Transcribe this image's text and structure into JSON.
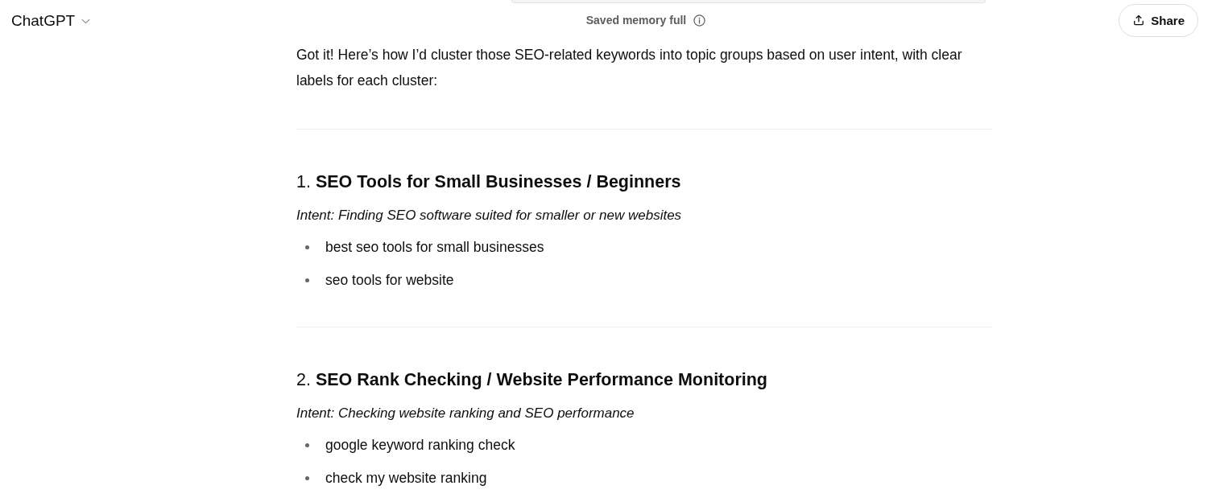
{
  "header": {
    "title": "ChatGPT",
    "notice": "Saved memory full",
    "share_button": "Share"
  },
  "message": {
    "intro": "Got it! Here’s how I’d cluster those SEO-related keywords into topic groups based on user intent, with clear labels for each cluster:",
    "clusters": [
      {
        "heading": "1. **SEO Tools for Small Businesses / Beginners**",
        "intent": "Intent: Finding SEO software suited for smaller or new websites",
        "keywords": [
          "best seo tools for small businesses",
          "seo tools for website"
        ]
      },
      {
        "heading": "2. **SEO Rank Checking / Website Performance Monitoring**",
        "intent": "Intent: Checking website ranking and SEO performance",
        "keywords": [
          "google keyword ranking check",
          "check my website ranking"
        ]
      }
    ]
  }
}
